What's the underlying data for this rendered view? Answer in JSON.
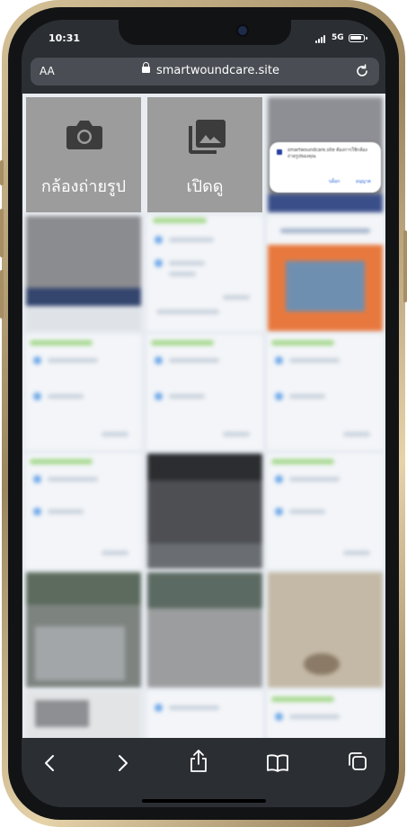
{
  "status_bar": {
    "time": "10:31",
    "network": "5G",
    "battery_level": 0.9
  },
  "address_bar": {
    "text_size_label": "AA",
    "url": "smartwoundcare.site"
  },
  "picker": {
    "camera_label": "กล้องถ่ายรูป",
    "gallery_label": "เปิดดู"
  },
  "permission_popup": {
    "message": "smartwoundcare.site ต้องการใช้กล้องถ่ายรูปของคุณ",
    "deny_label": "บล็อก",
    "allow_label": "อนุญาต"
  },
  "toolbar": {
    "back_icon": "back-chevron-icon",
    "forward_icon": "forward-chevron-icon",
    "share_icon": "share-icon",
    "bookmarks_icon": "book-icon",
    "tabs_icon": "tabs-icon"
  },
  "colors": {
    "bezel_gold": "#c9b183",
    "screen_bg": "#2b2e33",
    "tile_gray": "#9c9c9c"
  }
}
